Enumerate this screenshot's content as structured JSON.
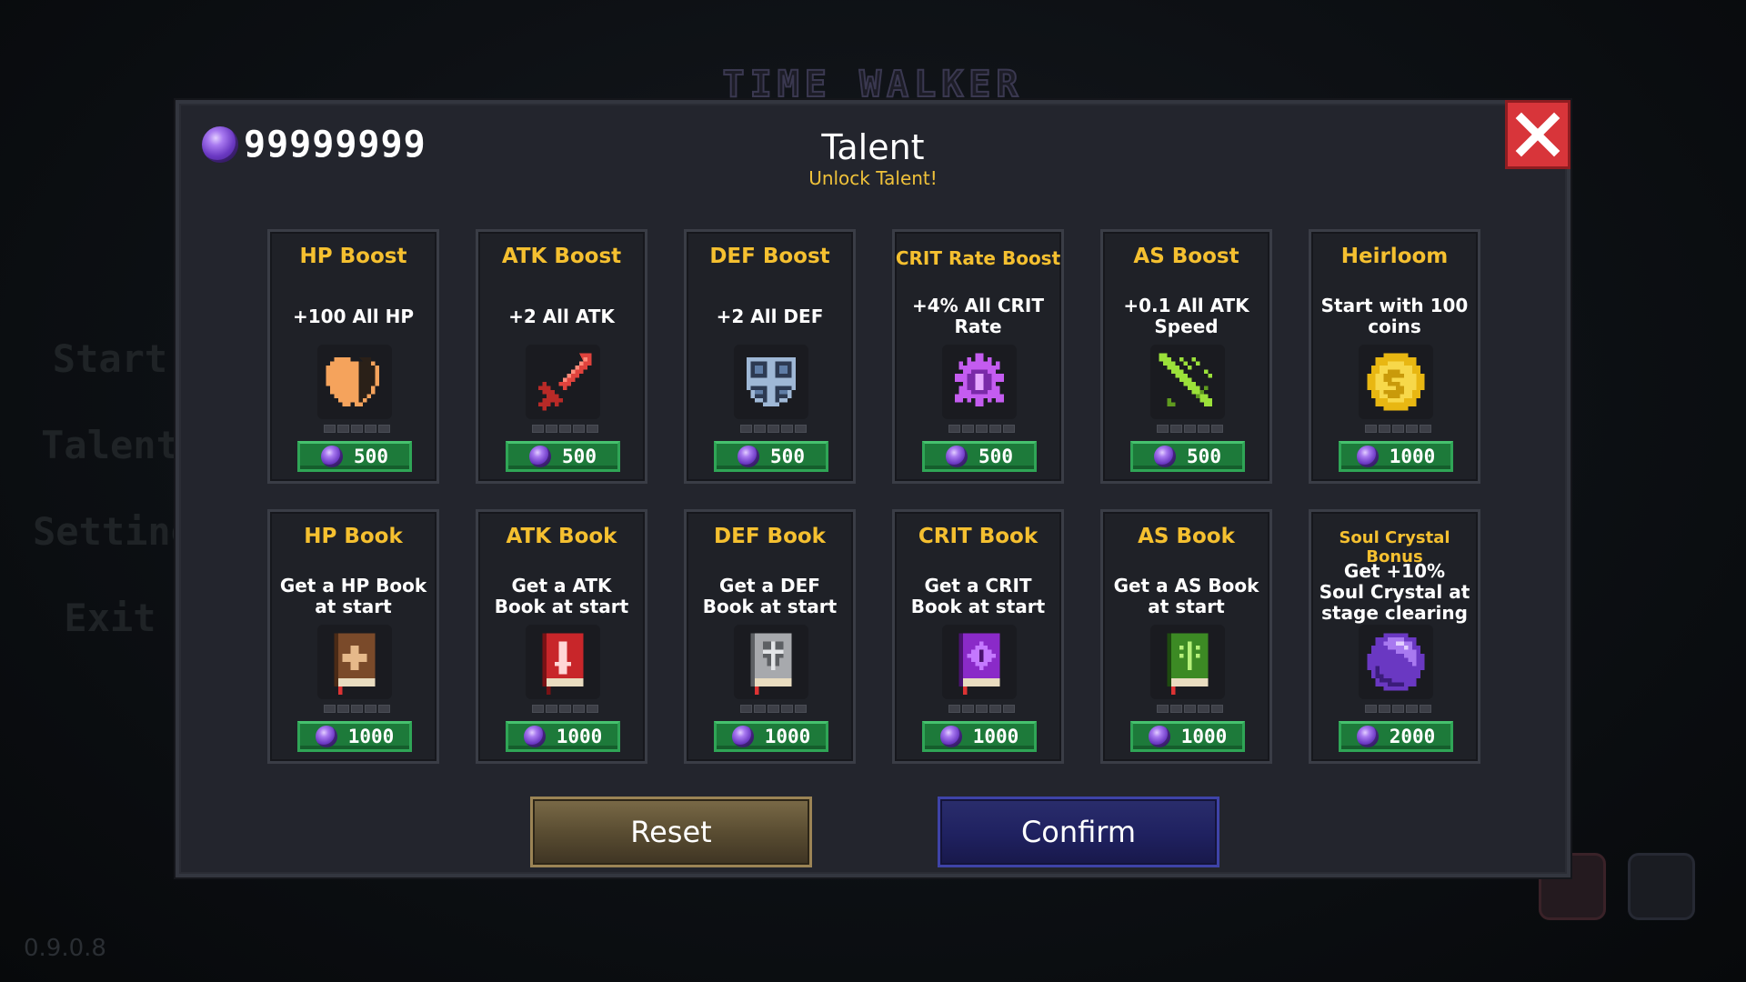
{
  "background": {
    "game_title": "TIME WALKER",
    "menu": [
      "Start",
      "Talent",
      "Setting",
      "Exit"
    ],
    "version": "0.9.0.8"
  },
  "modal": {
    "currency": "99999999",
    "title": "Talent",
    "subtitle": "Unlock Talent!",
    "reset_label": "Reset",
    "confirm_label": "Confirm"
  },
  "talents": [
    {
      "name": "HP Boost",
      "desc": "+100 All HP",
      "price": "500",
      "icon": "half-heart-icon"
    },
    {
      "name": "ATK Boost",
      "desc": "+2 All ATK",
      "price": "500",
      "icon": "sword-icon"
    },
    {
      "name": "DEF Boost",
      "desc": "+2 All DEF",
      "price": "500",
      "icon": "shield-icon"
    },
    {
      "name": "CRIT Rate Boost",
      "desc": "+4% All CRIT Rate",
      "price": "500",
      "icon": "crit-burst-icon"
    },
    {
      "name": "AS Boost",
      "desc": "+0.1 All ATK Speed",
      "price": "500",
      "icon": "fast-sword-icon"
    },
    {
      "name": "Heirloom",
      "desc": "Start with 100 coins",
      "price": "1000",
      "icon": "coin-icon"
    },
    {
      "name": "HP Book",
      "desc": "Get a HP Book at start",
      "price": "1000",
      "icon": "hp-book-icon"
    },
    {
      "name": "ATK Book",
      "desc": "Get a ATK Book at start",
      "price": "1000",
      "icon": "atk-book-icon"
    },
    {
      "name": "DEF Book",
      "desc": "Get a DEF Book at start",
      "price": "1000",
      "icon": "def-book-icon"
    },
    {
      "name": "CRIT Book",
      "desc": "Get a CRIT Book at start",
      "price": "1000",
      "icon": "crit-book-icon"
    },
    {
      "name": "AS Book",
      "desc": "Get a AS Book at start",
      "price": "1000",
      "icon": "as-book-icon"
    },
    {
      "name": "Soul Crystal Bonus",
      "desc": "Get +10% Soul Crystal at stage clearing",
      "price": "2000",
      "icon": "soul-crystal-icon"
    }
  ],
  "colors": {
    "accent_gold": "#f5c030",
    "price_green": "#1d7a3a",
    "close_red": "#d8353a",
    "soul_crystal_purple": "#6a38c2"
  }
}
